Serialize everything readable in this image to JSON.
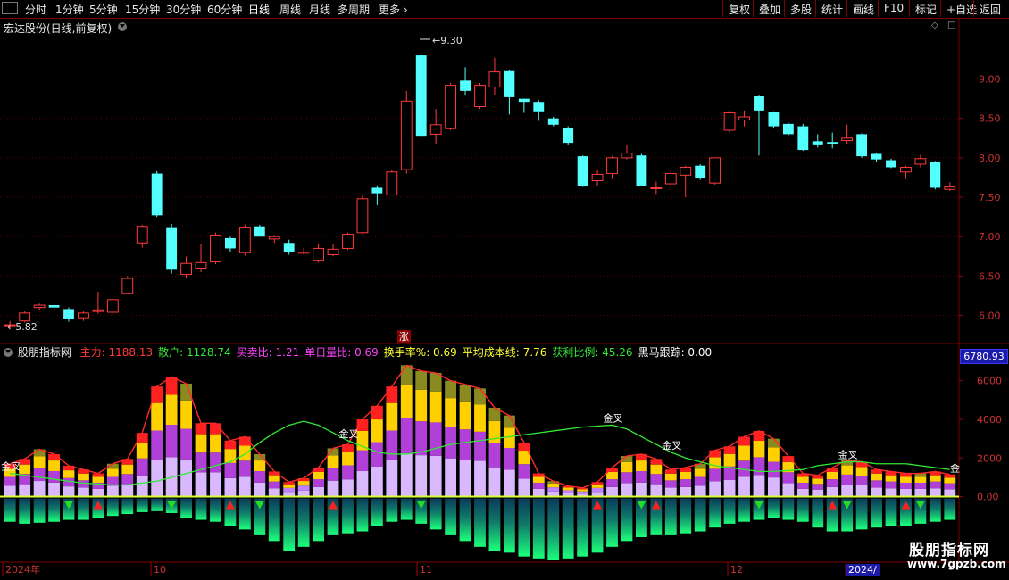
{
  "toolbar": {
    "periods": [
      "分时",
      "1分钟",
      "5分钟",
      "15分钟",
      "30分钟",
      "60分钟",
      "日线",
      "周线",
      "月线",
      "多周期",
      "更多"
    ],
    "active_period": "日线",
    "buttons": [
      "复权",
      "叠加",
      "多股",
      "统计",
      "画线",
      "F10",
      "标记",
      "+自选",
      "返回"
    ]
  },
  "symbol": {
    "title": "宏达股份(日线,前复权)"
  },
  "price_axis": {
    "labels": [
      "9.00",
      "8.50",
      "8.00",
      "7.50",
      "7.00",
      "6.50",
      "6.00"
    ],
    "ymin": 5.7,
    "ymax": 9.55
  },
  "annotations": {
    "high_label": "9.30",
    "low_label": "5.82",
    "zhang": "涨"
  },
  "indicator": {
    "name": "股朋指标网",
    "fields": [
      {
        "label": "主力:",
        "value": "1188.13",
        "color": "#ff3b3b"
      },
      {
        "label": "散户:",
        "value": "1128.74",
        "color": "#37e837"
      },
      {
        "label": "买卖比:",
        "value": "1.21",
        "color": "#ff44ff"
      },
      {
        "label": "单日量比:",
        "value": "0.69",
        "color": "#ff44ff"
      },
      {
        "label": "换手率%:",
        "value": "0.69",
        "color": "#ffff33"
      },
      {
        "label": "平均成本线:",
        "value": "7.76",
        "color": "#ffff33"
      },
      {
        "label": "获利比例:",
        "value": "45.26",
        "color": "#37e837"
      },
      {
        "label": "黑马跟踪:",
        "value": "0.00",
        "color": "#ffffff"
      }
    ],
    "axis_labels": [
      "6000",
      "4000",
      "2000",
      "0.00"
    ],
    "current_value": "6780.93",
    "cross_label": "金叉",
    "edge_label": "金"
  },
  "date_axis": {
    "labels": [
      "2024年",
      "10",
      "11",
      "12",
      "2024/"
    ]
  },
  "watermark": {
    "title": "股朋指标网",
    "url": "www.7gpzb.com"
  },
  "colors": {
    "up": "#ff3b3b",
    "down": "#54ffff",
    "bg": "#000000",
    "axis": "#800000"
  },
  "chart_data": {
    "type": "candlestick",
    "candles": [
      {
        "o": 5.88,
        "h": 5.93,
        "l": 5.82,
        "c": 5.88
      },
      {
        "o": 5.93,
        "h": 6.05,
        "l": 5.91,
        "c": 6.03
      },
      {
        "o": 6.1,
        "h": 6.15,
        "l": 6.07,
        "c": 6.13
      },
      {
        "o": 6.13,
        "h": 6.15,
        "l": 6.06,
        "c": 6.1
      },
      {
        "o": 6.08,
        "h": 6.1,
        "l": 5.92,
        "c": 5.96
      },
      {
        "o": 5.97,
        "h": 6.05,
        "l": 5.93,
        "c": 6.03
      },
      {
        "o": 6.05,
        "h": 6.3,
        "l": 6.02,
        "c": 6.07
      },
      {
        "o": 6.04,
        "h": 6.21,
        "l": 6.0,
        "c": 6.2
      },
      {
        "o": 6.28,
        "h": 6.5,
        "l": 6.27,
        "c": 6.47
      },
      {
        "o": 6.92,
        "h": 7.15,
        "l": 6.86,
        "c": 7.13
      },
      {
        "o": 7.8,
        "h": 7.83,
        "l": 7.25,
        "c": 7.27
      },
      {
        "o": 7.12,
        "h": 7.16,
        "l": 6.53,
        "c": 6.58
      },
      {
        "o": 6.52,
        "h": 6.75,
        "l": 6.47,
        "c": 6.66
      },
      {
        "o": 6.6,
        "h": 6.9,
        "l": 6.55,
        "c": 6.67
      },
      {
        "o": 6.68,
        "h": 7.05,
        "l": 6.65,
        "c": 7.02
      },
      {
        "o": 6.98,
        "h": 7.0,
        "l": 6.81,
        "c": 6.85
      },
      {
        "o": 6.8,
        "h": 7.15,
        "l": 6.76,
        "c": 7.12
      },
      {
        "o": 7.13,
        "h": 7.15,
        "l": 7.0,
        "c": 7.0
      },
      {
        "o": 6.97,
        "h": 7.02,
        "l": 6.92,
        "c": 7.0
      },
      {
        "o": 6.92,
        "h": 6.96,
        "l": 6.77,
        "c": 6.81
      },
      {
        "o": 6.8,
        "h": 6.86,
        "l": 6.77,
        "c": 6.8
      },
      {
        "o": 6.7,
        "h": 6.9,
        "l": 6.67,
        "c": 6.85
      },
      {
        "o": 6.77,
        "h": 6.9,
        "l": 6.75,
        "c": 6.84
      },
      {
        "o": 6.85,
        "h": 7.05,
        "l": 6.83,
        "c": 7.03
      },
      {
        "o": 7.05,
        "h": 7.52,
        "l": 7.03,
        "c": 7.48
      },
      {
        "o": 7.62,
        "h": 7.65,
        "l": 7.4,
        "c": 7.55
      },
      {
        "o": 7.53,
        "h": 7.85,
        "l": 7.52,
        "c": 7.82
      },
      {
        "o": 7.85,
        "h": 8.85,
        "l": 7.8,
        "c": 8.72
      },
      {
        "o": 9.3,
        "h": 9.33,
        "l": 8.27,
        "c": 8.28
      },
      {
        "o": 8.3,
        "h": 8.62,
        "l": 8.18,
        "c": 8.42
      },
      {
        "o": 8.37,
        "h": 8.95,
        "l": 8.35,
        "c": 8.92
      },
      {
        "o": 8.98,
        "h": 9.15,
        "l": 8.79,
        "c": 8.85
      },
      {
        "o": 8.65,
        "h": 8.95,
        "l": 8.62,
        "c": 8.92
      },
      {
        "o": 8.9,
        "h": 9.27,
        "l": 8.8,
        "c": 9.09
      },
      {
        "o": 9.1,
        "h": 9.12,
        "l": 8.55,
        "c": 8.77
      },
      {
        "o": 8.75,
        "h": 8.75,
        "l": 8.57,
        "c": 8.71
      },
      {
        "o": 8.71,
        "h": 8.73,
        "l": 8.47,
        "c": 8.59
      },
      {
        "o": 8.5,
        "h": 8.52,
        "l": 8.4,
        "c": 8.42
      },
      {
        "o": 8.38,
        "h": 8.4,
        "l": 8.16,
        "c": 8.19
      },
      {
        "o": 8.02,
        "h": 8.03,
        "l": 7.63,
        "c": 7.64
      },
      {
        "o": 7.71,
        "h": 7.85,
        "l": 7.64,
        "c": 7.79
      },
      {
        "o": 7.8,
        "h": 8.02,
        "l": 7.73,
        "c": 8.0
      },
      {
        "o": 8.0,
        "h": 8.17,
        "l": 7.98,
        "c": 8.06
      },
      {
        "o": 8.03,
        "h": 8.05,
        "l": 7.64,
        "c": 7.64
      },
      {
        "o": 7.62,
        "h": 7.7,
        "l": 7.54,
        "c": 7.62
      },
      {
        "o": 7.67,
        "h": 7.86,
        "l": 7.63,
        "c": 7.8
      },
      {
        "o": 7.78,
        "h": 7.9,
        "l": 7.5,
        "c": 7.88
      },
      {
        "o": 7.9,
        "h": 7.92,
        "l": 7.72,
        "c": 7.74
      },
      {
        "o": 7.68,
        "h": 8.0,
        "l": 7.66,
        "c": 8.0
      },
      {
        "o": 8.35,
        "h": 8.6,
        "l": 8.32,
        "c": 8.57
      },
      {
        "o": 8.48,
        "h": 8.6,
        "l": 8.4,
        "c": 8.52
      },
      {
        "o": 8.78,
        "h": 8.79,
        "l": 8.03,
        "c": 8.6
      },
      {
        "o": 8.58,
        "h": 8.59,
        "l": 8.38,
        "c": 8.4
      },
      {
        "o": 8.43,
        "h": 8.45,
        "l": 8.28,
        "c": 8.3
      },
      {
        "o": 8.4,
        "h": 8.43,
        "l": 8.09,
        "c": 8.1
      },
      {
        "o": 8.21,
        "h": 8.3,
        "l": 8.13,
        "c": 8.17
      },
      {
        "o": 8.2,
        "h": 8.32,
        "l": 8.12,
        "c": 8.18
      },
      {
        "o": 8.22,
        "h": 8.42,
        "l": 8.18,
        "c": 8.25
      },
      {
        "o": 8.3,
        "h": 8.31,
        "l": 8.0,
        "c": 8.02
      },
      {
        "o": 8.05,
        "h": 8.06,
        "l": 7.95,
        "c": 7.98
      },
      {
        "o": 7.97,
        "h": 7.99,
        "l": 7.87,
        "c": 7.88
      },
      {
        "o": 7.82,
        "h": 7.9,
        "l": 7.73,
        "c": 7.88
      },
      {
        "o": 7.92,
        "h": 8.04,
        "l": 7.88,
        "c": 7.99
      },
      {
        "o": 7.95,
        "h": 7.96,
        "l": 7.6,
        "c": 7.62
      },
      {
        "o": 7.6,
        "h": 7.69,
        "l": 7.58,
        "c": 7.63
      }
    ],
    "indicator_series": {
      "ymin": -3300,
      "ymax": 7000,
      "bars_top": [
        1700,
        1950,
        2450,
        2200,
        1600,
        1400,
        1200,
        1700,
        1950,
        3300,
        5700,
        6200,
        5850,
        3800,
        3800,
        2900,
        3100,
        2200,
        1300,
        750,
        950,
        1500,
        2500,
        2700,
        4000,
        4700,
        5700,
        6800,
        6500,
        6400,
        6000,
        5800,
        5600,
        4600,
        4200,
        2800,
        1200,
        800,
        550,
        450,
        750,
        1500,
        2100,
        2200,
        1950,
        1400,
        1500,
        1700,
        2400,
        2600,
        3100,
        3400,
        3000,
        2100,
        1200,
        1100,
        1500,
        1900,
        1800,
        1400,
        1300,
        1200,
        1200,
        1300,
        1150
      ],
      "bars_bottom": [
        -1300,
        -1400,
        -1350,
        -1300,
        -1200,
        -1200,
        -1100,
        -1000,
        -900,
        -800,
        -750,
        -850,
        -1100,
        -1200,
        -1300,
        -1500,
        -1700,
        -2000,
        -2300,
        -2800,
        -2600,
        -2300,
        -2000,
        -1900,
        -1800,
        -1500,
        -1300,
        -1200,
        -1400,
        -1700,
        -2000,
        -2300,
        -2600,
        -2800,
        -2900,
        -3100,
        -3200,
        -3300,
        -3200,
        -3100,
        -2900,
        -2600,
        -2300,
        -2100,
        -2000,
        -2000,
        -1900,
        -1800,
        -1600,
        -1400,
        -1300,
        -1200,
        -1100,
        -1200,
        -1300,
        -1600,
        -1800,
        -1800,
        -1700,
        -1600,
        -1500,
        -1500,
        -1400,
        -1300,
        -1200
      ],
      "green_line": [
        1200,
        1100,
        1000,
        900,
        800,
        700,
        650,
        600,
        600,
        700,
        800,
        1000,
        1200,
        1400,
        1600,
        1800,
        2200,
        2800,
        3300,
        3700,
        3900,
        3700,
        3300,
        2900,
        2600,
        2300,
        2200,
        2200,
        2300,
        2500,
        2700,
        2800,
        2900,
        3000,
        3100,
        3200,
        3300,
        3400,
        3500,
        3600,
        3650,
        3700,
        3500,
        3100,
        2700,
        2300,
        2000,
        1800,
        1600,
        1500,
        1400,
        1300,
        1300,
        1350,
        1400,
        1600,
        1700,
        1800,
        1800,
        1700,
        1700,
        1700,
        1600,
        1500,
        1400
      ],
      "up_arrows": [
        6,
        15,
        22,
        40,
        44,
        56,
        61
      ],
      "down_arrows": [
        4,
        11,
        17,
        28,
        43,
        51,
        57,
        62
      ],
      "cross_points": [
        0,
        23,
        41,
        45,
        57
      ]
    }
  }
}
